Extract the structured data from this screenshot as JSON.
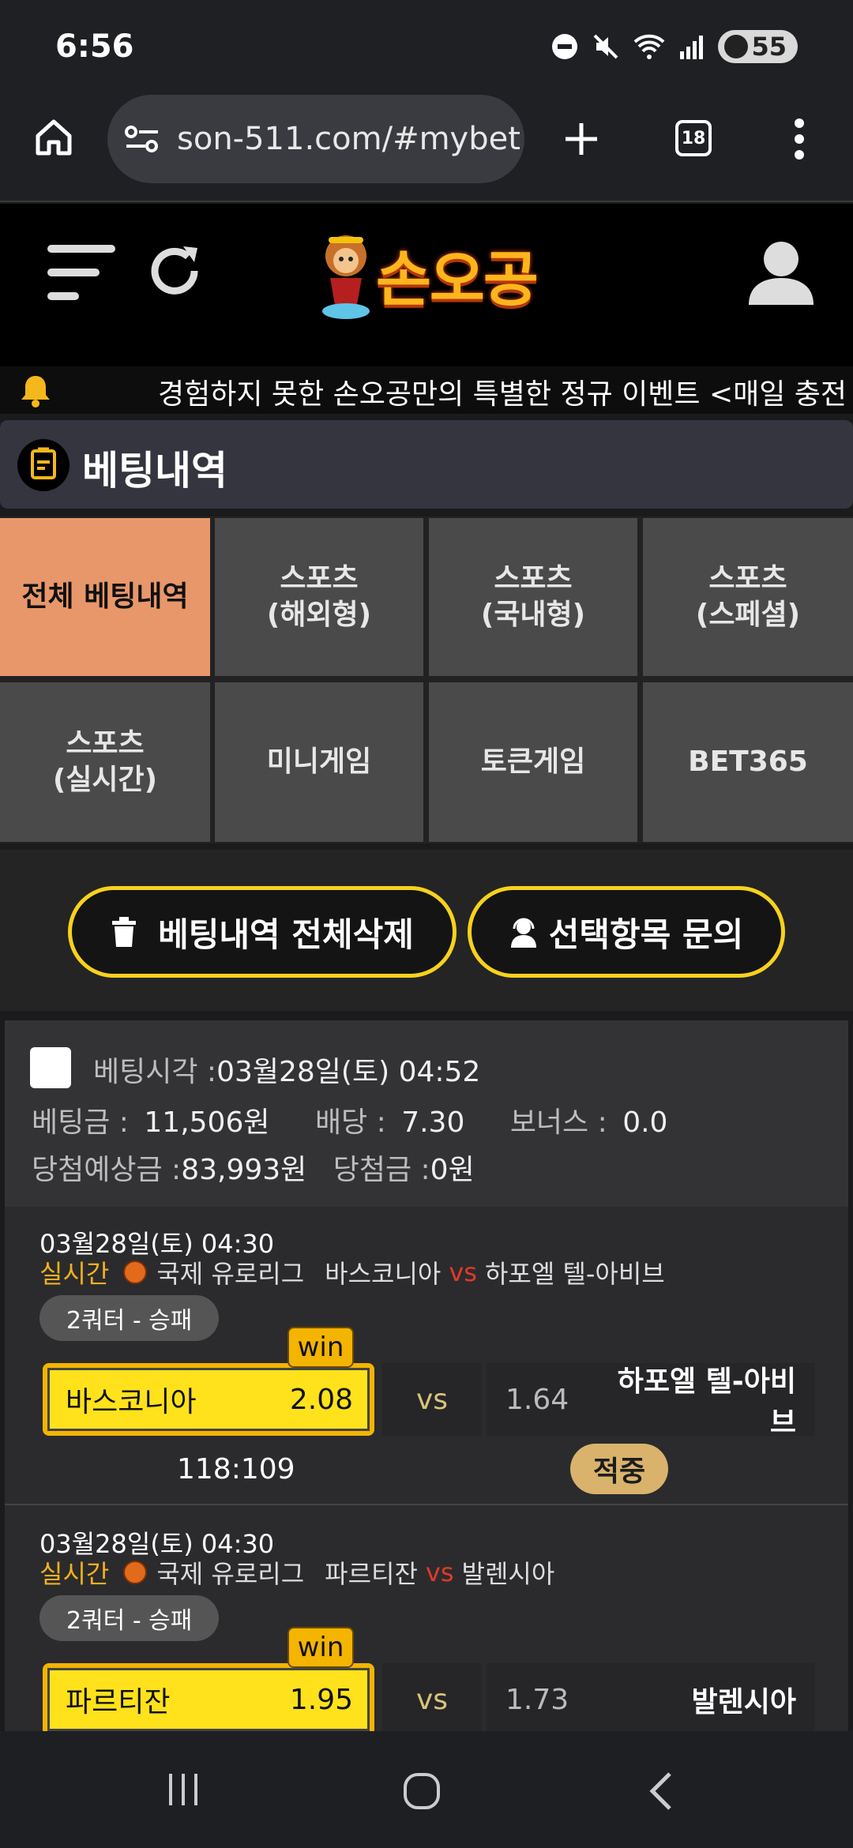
{
  "status_bar": {
    "time": "6:56",
    "battery": "55"
  },
  "browser": {
    "url": "son-511.com/#mybet",
    "tab_count": "18"
  },
  "site": {
    "logo_text": "손오공"
  },
  "marquee": {
    "text": "경험하지 못한 손오공만의 특별한 정규 이벤트 <매일 충전"
  },
  "section": {
    "title": "베팅내역"
  },
  "tabs": [
    {
      "label": "전체 베팅내역"
    },
    {
      "label": "스포츠\n(해외형)"
    },
    {
      "label": "스포츠\n(국내형)"
    },
    {
      "label": "스포츠\n(스페셜)"
    },
    {
      "label": "스포츠\n(실시간)"
    },
    {
      "label": "미니게임"
    },
    {
      "label": "토큰게임"
    },
    {
      "label": "BET365"
    }
  ],
  "actions": {
    "delete_all": "베팅내역 전체삭제",
    "inquiry": "선택항목 문의"
  },
  "bet": {
    "time_label": "베팅시각 :",
    "time_value": "03월28일(토) 04:52",
    "amount_label": "베팅금 :",
    "amount_value": "11,506원",
    "odds_label": "배당 :",
    "odds_value": "7.30",
    "bonus_label": "보너스 :",
    "bonus_value": "0.0",
    "expected_label": "당첨예상금 :",
    "expected_value": "83,993원",
    "win_label": "당첨금 :",
    "win_value": "0원"
  },
  "matches": [
    {
      "date": "03월28일(토) 04:30",
      "live": "실시간",
      "league": "국제 유로리그",
      "home": "바스코니아",
      "vs": "vs",
      "away": "하포엘 텔-아비브",
      "market": "2쿼터 - 승패",
      "pick_team": "바스코니아",
      "pick_odds": "2.08",
      "pick_badge": "win",
      "middle": "vs",
      "away_odds": "1.64",
      "score": "118:109",
      "result": "적중"
    },
    {
      "date": "03월28일(토) 04:30",
      "live": "실시간",
      "league": "국제 유로리그",
      "home": "파르티잔",
      "vs": "vs",
      "away": "발렌시아",
      "market": "2쿼터 - 승패",
      "pick_team": "파르티잔",
      "pick_odds": "1.95",
      "pick_badge": "win",
      "middle": "vs",
      "away_odds": "1.73"
    }
  ]
}
